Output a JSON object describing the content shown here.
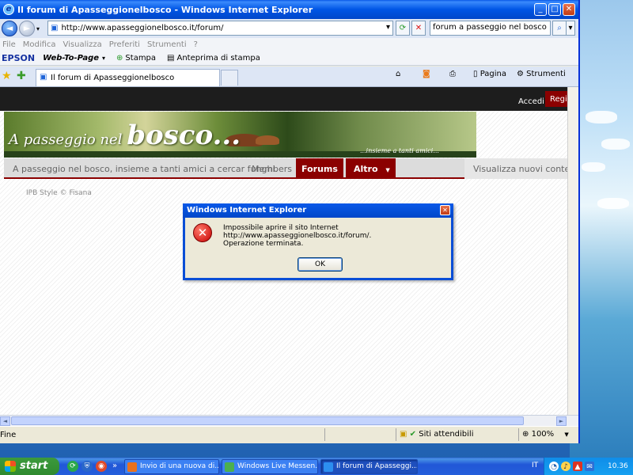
{
  "window": {
    "title": "Il forum di Apasseggionelbosco - Windows Internet Explorer",
    "controls": {
      "minimize": "_",
      "maximize": "□",
      "close": "✕"
    }
  },
  "address_bar": {
    "url": "http://www.apasseggionelbosco.it/forum/",
    "search_value": "forum a passeggio nel bosco",
    "back_icon": "◄",
    "forward_icon": "►",
    "dropdown_icon": "▾",
    "refresh_icon": "⟳",
    "stop_icon": "✕",
    "search_icon": "⌕"
  },
  "menu": [
    "File",
    "Modifica",
    "Visualizza",
    "Preferiti",
    "Strumenti",
    "?"
  ],
  "epson_bar": {
    "brand": "EPSON",
    "web_to_page": "Web-To-Page",
    "dropdown_icon": "▾",
    "print": "Stampa",
    "print_preview": "Anteprima di stampa"
  },
  "tabs": {
    "active": "Il forum di Apasseggionelbosco",
    "tools": {
      "page": "Pagina",
      "tools": "Strumenti"
    }
  },
  "site": {
    "login": "Accedi",
    "register": "Registrati",
    "banner": {
      "title_small": "A passeggio nel",
      "title_big": "bosco...",
      "tagline": "...insieme a tanti amici..."
    },
    "nav": {
      "intro": "A passeggio nel bosco, insieme a tanti amici a cercar funghi.",
      "members": "Members",
      "forums": "Forums",
      "more": "Altro",
      "more_arrow": "▼",
      "new_content": "Visualizza nuovi contenuti"
    },
    "footer": "IPB Style ©  Fisana"
  },
  "dialog": {
    "title": "Windows Internet Explorer",
    "close": "✕",
    "icon": "✕",
    "message": "Impossibile aprire il sito Internet http://www.apasseggionelbosco.it/forum/.",
    "detail": "Operazione terminata.",
    "ok": "OK"
  },
  "status_bar": {
    "left": "Fine",
    "zone": "Siti attendibili",
    "zoom": "100%"
  },
  "taskbar": {
    "start": "start",
    "items": [
      {
        "label": "Invio di una nuova di...",
        "icon_color": "#e8711f"
      },
      {
        "label": "Windows Live Messen...",
        "icon_color": "#4caf50"
      },
      {
        "label": "Il forum di Apasseggi...",
        "icon_color": "#2c8ef0"
      }
    ],
    "language": "IT",
    "clock": "10.36"
  },
  "colors": {
    "accent_red": "#8b0000",
    "xp_blue": "#0a4ed6",
    "taskbar_green": "#3c9a3c"
  }
}
